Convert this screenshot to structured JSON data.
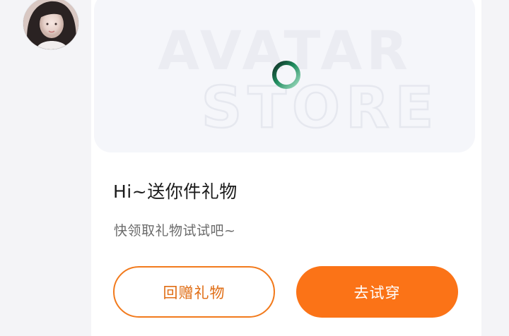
{
  "user": {
    "avatar_icon": "user-avatar-photo"
  },
  "banner": {
    "watermark_line1": "AVATAR",
    "watermark_line2": "STORE",
    "loading_icon": "loading-spinner-icon"
  },
  "card": {
    "title": "Hi~送你件礼物",
    "subtitle": "快领取礼物试试吧~"
  },
  "actions": {
    "return_gift_label": "回赠礼物",
    "try_on_label": "去试穿"
  },
  "colors": {
    "accent": "#fb7317",
    "accent_border": "#f27a1c",
    "accent_text": "#e06d14",
    "page_bg": "#f4f4f7",
    "card_bg": "#ffffff",
    "banner_bg": "#f5f6fa"
  }
}
